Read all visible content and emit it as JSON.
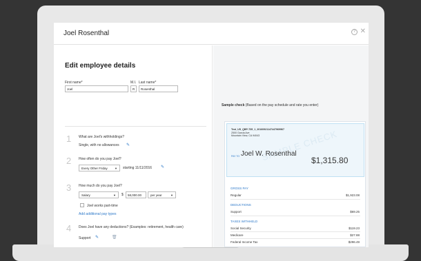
{
  "window": {
    "title": "Joel Rosenthal"
  },
  "form": {
    "heading": "Edit employee details",
    "first_name_label": "First name*",
    "mi_label": "M.I.",
    "last_name_label": "Last name*",
    "first_name_value": "Joel",
    "mi_value": "R",
    "last_name_value": "Rosenthal"
  },
  "steps": [
    {
      "number": "1",
      "question": "What are Joel's withholdings?",
      "answer": "Single, with no allowances"
    },
    {
      "number": "2",
      "question": "How often do you pay Joel?",
      "frequency": "Every Other Friday",
      "starting": "starting 11/11/2016"
    },
    {
      "number": "3",
      "question": "How much do you pay Joel?",
      "pay_type": "Salary",
      "currency": "$",
      "amount": "58,000.00",
      "period": "per year",
      "part_time_label": "Joel works part-time",
      "add_pay_types": "Add additional pay types"
    },
    {
      "number": "4",
      "question": "Does Joel have any deductions? (Examples: retirement, health care)",
      "deduction": "Support"
    }
  ],
  "sample": {
    "label_bold": "Sample check",
    "label_note": "(Based on the pay schedule and rate you enter)",
    "company_lines": [
      "Test_US_QBP-T35_1_20160921147447969967",
      "2500 Garcia Ave",
      "Mountain View, CA 94043"
    ],
    "pay_to": "PAY TO",
    "payee": "Joel W. Rosenthal",
    "amount": "$1,315.80",
    "watermark": "SAMPLE CHECK",
    "gross_pay_title": "GROSS PAY",
    "gross_rows": [
      {
        "label": "Regular",
        "value": "$1,923.08"
      }
    ],
    "deductions_title": "DEDUCTIONS",
    "deduction_rows": [
      {
        "label": "Support",
        "value": "$69.25"
      }
    ],
    "taxes_title": "TAXES WITHHELD",
    "tax_rows": [
      {
        "label": "Social Security",
        "value": "$119.23"
      },
      {
        "label": "Medicare",
        "value": "$27.88"
      },
      {
        "label": "Federal Income Tax",
        "value": "$296.49"
      }
    ]
  },
  "colors": {
    "accent": "#2b77c8",
    "frame": "#343434",
    "laptop": "#e8e8e8"
  }
}
